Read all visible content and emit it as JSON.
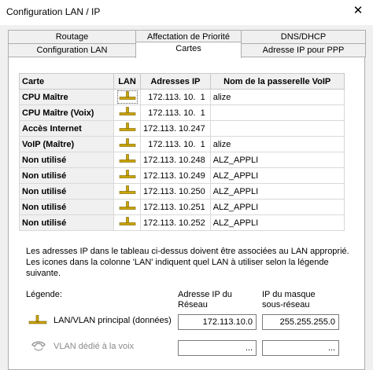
{
  "window": {
    "title": "Configuration LAN / IP",
    "close_glyph": "✕"
  },
  "tabs": {
    "row1": [
      "Routage",
      "Affectation de Priorité",
      "DNS/DHCP"
    ],
    "row2": [
      "Configuration LAN",
      "Cartes",
      "Adresse IP pour PPP"
    ],
    "active": "Cartes"
  },
  "table": {
    "columns": [
      "Carte",
      "LAN",
      "Adresses IP",
      "Nom de la passerelle VoIP"
    ],
    "rows": [
      {
        "carte": "CPU Maître",
        "ip": "172.113. 10.  1",
        "gw": "alize",
        "selected": true
      },
      {
        "carte": "CPU Maître (Voix)",
        "ip": "172.113. 10.  1",
        "gw": "",
        "selected": false
      },
      {
        "carte": "Accès Internet",
        "ip": "172.113. 10.247",
        "gw": "",
        "selected": false
      },
      {
        "carte": "VoIP (Maître)",
        "ip": "172.113. 10.  1",
        "gw": "alize",
        "selected": false
      },
      {
        "carte": "Non utilisé",
        "ip": "172.113. 10.248",
        "gw": "ALZ_APPLI",
        "selected": false
      },
      {
        "carte": "Non utilisé",
        "ip": "172.113. 10.249",
        "gw": "ALZ_APPLI",
        "selected": false
      },
      {
        "carte": "Non utilisé",
        "ip": "172.113. 10.250",
        "gw": "ALZ_APPLI",
        "selected": false
      },
      {
        "carte": "Non utilisé",
        "ip": "172.113. 10.251",
        "gw": "ALZ_APPLI",
        "selected": false
      },
      {
        "carte": "Non utilisé",
        "ip": "172.113. 10.252",
        "gw": "ALZ_APPLI",
        "selected": false
      }
    ],
    "lan_icon": "lan-network-icon"
  },
  "note": "Les adresses IP dans le tableau ci-dessus doivent être associées au LAN approprié. Les icones dans la colonne 'LAN' indiquent quel LAN à utiliser selon la légende suivante.",
  "legend": {
    "label": "Légende:",
    "col_ip_line1": "Adresse IP du",
    "col_ip_line2": "Réseau",
    "col_mask_line1": "IP du masque",
    "col_mask_line2": "sous-réseau",
    "lan_label": "LAN/VLAN principal (données)",
    "lan_ip": "172.113.10.0",
    "lan_mask": "255.255.255.0",
    "voice_label": "VLAN dédié à la voix",
    "voice_ip": "...",
    "voice_mask": "...",
    "lan_icon": "lan-network-icon",
    "voice_icon": "phone-handset-icon"
  }
}
